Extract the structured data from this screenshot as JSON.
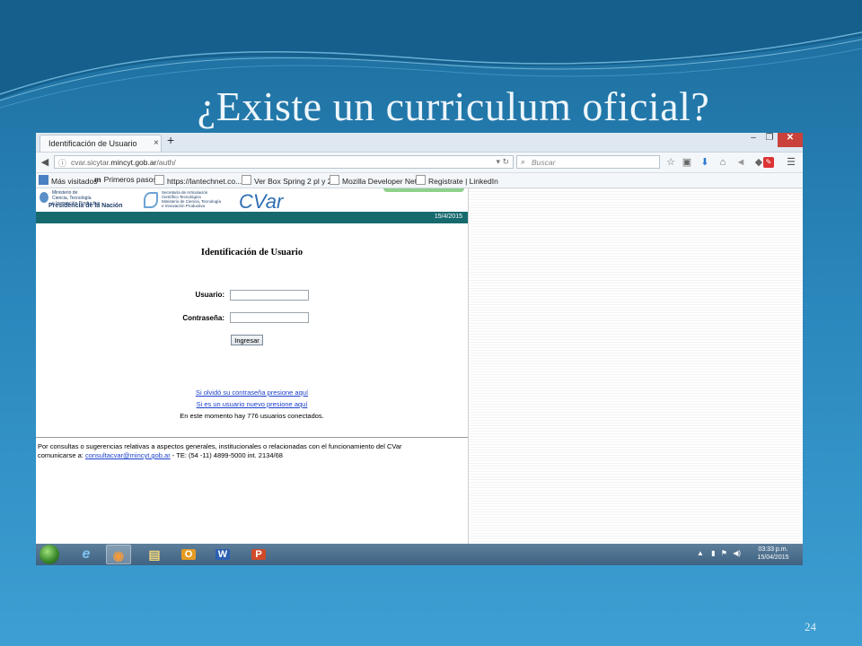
{
  "slide": {
    "title": "¿Existe un curriculum oficial?",
    "number": "24"
  },
  "browser": {
    "tab_title": "Identificación de Usuario",
    "tab_close": "×",
    "new_tab": "+",
    "window_controls": {
      "minimize": "–",
      "maximize": "❐",
      "close": "✕"
    },
    "url_prefix": "cvar.sicytar.",
    "url_host": "mincyt.gob.ar",
    "url_path": "/auth/",
    "search_placeholder": "Buscar",
    "bookmarks": [
      {
        "label": "Más visitados"
      },
      {
        "label": "Primeros pasos"
      },
      {
        "label": "https://lantechnet.co..."
      },
      {
        "label": "Ver Box Spring 2 pl y 2 ..."
      },
      {
        "label": "Mozilla Developer Net..."
      },
      {
        "label": "Registrate | LinkedIn"
      }
    ]
  },
  "page": {
    "gov_logo_lines": [
      "Ministerio de",
      "Ciencia, Tecnología",
      "e Innovación Productiva"
    ],
    "gov_logo_main": "Presidencia de la Nación",
    "secretaria_lines": [
      "Secretaría de Articulación",
      "Científico Tecnológica",
      "Ministerio de Ciencia, Tecnología",
      "e Innovación Productiva"
    ],
    "cvar_logo": "CVar",
    "date": "15/4/2015",
    "form_title": "Identificación de Usuario",
    "usuario_label": "Usuario:",
    "password_label": "Contraseña:",
    "submit_label": "Ingresar",
    "forgot_link": "Si olvidó su contraseña presione aquí",
    "new_user_link": "Si es un usuario nuevo presione aquí",
    "status": "En este momento hay 776 usuarios conectados.",
    "footer_line1": "Por consultas o sugerencias relativas a aspectos generales, institucionales o relacionadas con el funcionamiento del CVar",
    "footer_prefix": "comunicarse a: ",
    "footer_email": "consultacvar@mincyt.gob.ar",
    "footer_suffix": " - TE: (54 -11) 4899-5000 int. 2134/68"
  },
  "taskbar": {
    "apps": [
      {
        "name": "internet-explorer",
        "glyph": "e",
        "color": "#2a8be0"
      },
      {
        "name": "firefox",
        "glyph": "◉",
        "color": "#e8742c"
      },
      {
        "name": "file-explorer",
        "glyph": "▤",
        "color": "#e7c65a"
      },
      {
        "name": "outlook",
        "glyph": "O",
        "color": "#e59b22"
      },
      {
        "name": "word",
        "glyph": "W",
        "color": "#2b5fb3"
      },
      {
        "name": "powerpoint",
        "glyph": "P",
        "color": "#d04a2a"
      }
    ],
    "time": "03:33 p.m.",
    "date": "15/04/2015"
  },
  "colors": {
    "teal_band": "#166a6e",
    "link": "#1a3fcc",
    "close_button": "#c9413a"
  }
}
